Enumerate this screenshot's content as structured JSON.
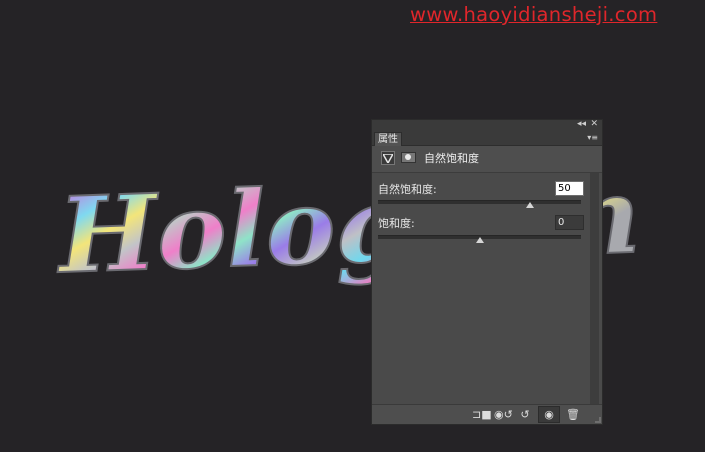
{
  "watermark": "www.haoyidiansheji.com",
  "canvas": {
    "artwork_text": "Hologram",
    "background_color": "#252326"
  },
  "panel": {
    "tab_label": "属性",
    "collapse_icon": "double-chevron-left-icon",
    "close_icon": "close-icon",
    "menu_icon": "panel-menu-icon",
    "header": {
      "adjustment_icon": "vibrance-triangle-icon",
      "mask_icon": "layer-mask-icon",
      "title": "自然饱和度"
    },
    "vibrance": {
      "label": "自然饱和度:",
      "value": "50",
      "slider_fraction": 0.75
    },
    "saturation": {
      "label": "饱和度:",
      "value": "0",
      "slider_fraction": 0.5
    },
    "bottom_icons": [
      "clip-to-layer-icon",
      "view-previous-state-icon",
      "reset-icon",
      "visibility-eye-icon",
      "trash-icon"
    ]
  }
}
